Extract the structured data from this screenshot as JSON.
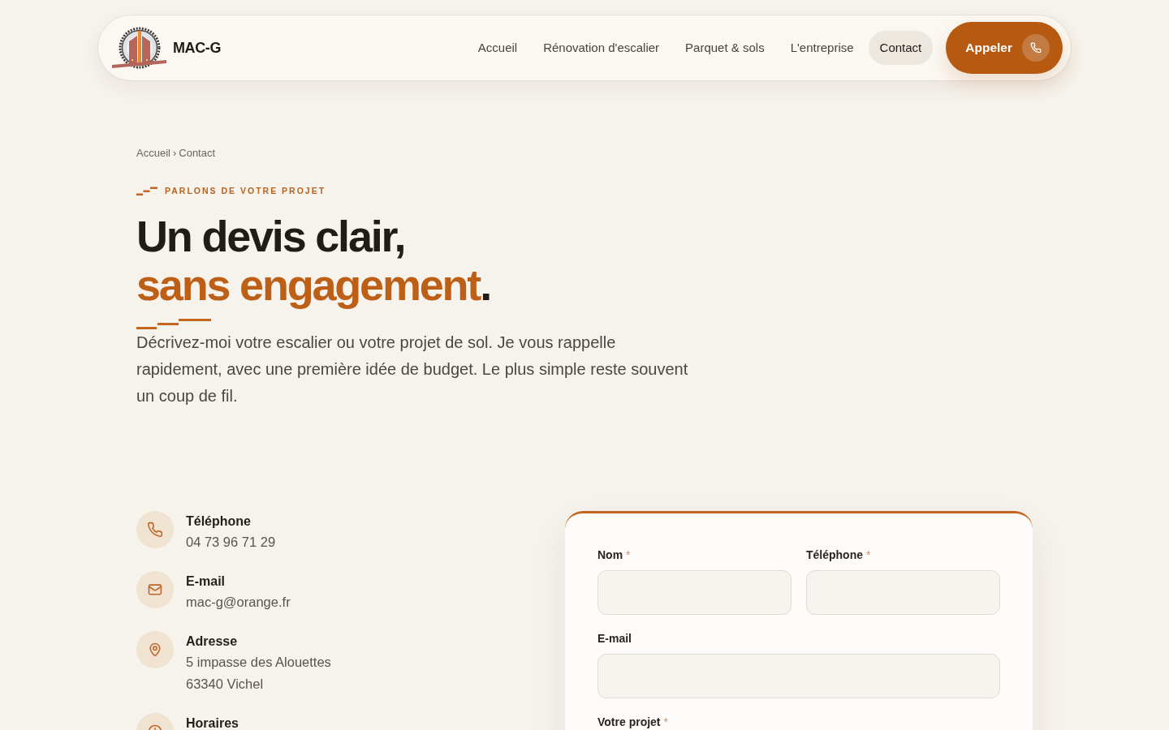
{
  "header": {
    "brand": {
      "name": "MAC-G"
    },
    "nav": [
      {
        "label": "Accueil",
        "selected": false
      },
      {
        "label": "Rénovation d'escalier",
        "selected": false
      },
      {
        "label": "Parquet & sols",
        "selected": false
      },
      {
        "label": "L'entreprise",
        "selected": false
      },
      {
        "label": "Contact",
        "selected": true
      }
    ],
    "call_button": {
      "label": "Appeler"
    }
  },
  "breadcrumb": {
    "items": [
      {
        "label": "Accueil"
      },
      {
        "label": "Contact"
      }
    ],
    "separator": "›"
  },
  "hero": {
    "eyebrow": "PARLONS DE VOTRE PROJET",
    "heading": {
      "plain": "Un devis clair,",
      "accent": "sans engagement",
      "end": "."
    },
    "lead": "Décrivez-moi votre escalier ou votre projet de sol. Je vous rappelle rapidement, avec une première idée de budget. Le plus simple reste souvent un coup de fil."
  },
  "contact_list": [
    {
      "kind": "phone",
      "label": "Téléphone",
      "lines": [
        "04 73 96 71 29"
      ]
    },
    {
      "kind": "email",
      "label": "E-mail",
      "lines": [
        "mac-g@orange.fr"
      ]
    },
    {
      "kind": "address",
      "label": "Adresse",
      "lines": [
        "5 impasse des Alouettes",
        "63340 Vichel"
      ]
    },
    {
      "kind": "hours",
      "label": "Horaires"
    }
  ],
  "form": {
    "required_mark": "*",
    "rows": [
      {
        "fields": [
          {
            "label": "Nom",
            "required": true,
            "kind": "input"
          },
          {
            "label": "Téléphone",
            "required": true,
            "kind": "input"
          }
        ]
      },
      {
        "fields": [
          {
            "label": "E-mail",
            "required": false,
            "kind": "input"
          }
        ]
      },
      {
        "fields": [
          {
            "label": "Votre projet",
            "required": true,
            "kind": "label"
          }
        ]
      }
    ]
  }
}
